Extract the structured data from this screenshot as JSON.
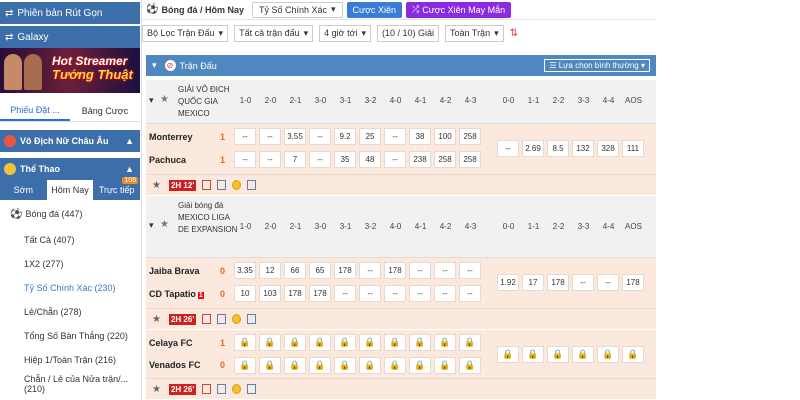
{
  "sidebar": {
    "btn_rutgon": "Phiên bản Rút Gọn",
    "btn_galaxy": "Galaxy",
    "banner_line1": "Hot Streamer",
    "banner_line2": "Tướng Thuật",
    "tabs": [
      "Phiếu Đặt ...",
      "Bảng Cược"
    ],
    "section_women": "Vô Địch Nữ Châu Âu",
    "section_sport": "Thể Thao",
    "subtabs": [
      "Sớm",
      "Hôm Nay",
      "Trực tiếp"
    ],
    "live_badge": "108",
    "menu": [
      {
        "label": "Bóng đá (447)"
      },
      {
        "label": "Tất Cả (407)"
      },
      {
        "label": "1X2 (277)"
      },
      {
        "label": "Tỷ Số Chính Xác (230)"
      },
      {
        "label": "Lẻ/Chẵn (278)"
      },
      {
        "label": "Tổng Số Bàn Thắng (220)"
      },
      {
        "label": "Hiệp 1/Toàn Trận (216)"
      },
      {
        "label": "Chẵn / Lẻ của Nửa trận/... (210)"
      }
    ]
  },
  "topbar": {
    "breadcrumb": "Bóng đá / Hôm Nay",
    "market_select": "Tỷ Số Chính Xác",
    "cuoc_xien": "Cược Xiên",
    "cuoc_xien_mm": "Cược Xiên May Mắn"
  },
  "filters": {
    "league": "Bộ Lọc Trận Đấu",
    "all": "Tất cả trận đấu",
    "time": "4 giờ tới",
    "count": "(10 / 10) Giải",
    "full": "Toàn Trận"
  },
  "main": {
    "header_title": "Trận Đấu",
    "sort_label": "Lựa chọn bình thường",
    "columns": [
      "1-0",
      "2-0",
      "2-1",
      "3-0",
      "3-1",
      "3-2",
      "4-0",
      "4-1",
      "4-2",
      "4-3",
      "0-0",
      "1-1",
      "2-2",
      "3-3",
      "4-4",
      "AOS"
    ],
    "leagues": [
      {
        "name": "GIẢI VÔ ĐỊCH QUỐC GIA MEXICO",
        "match": {
          "home": "Monterrey",
          "home_score": "1",
          "away": "Pachuca",
          "away_score": "1",
          "home_odds": [
            "--",
            "--",
            "3.55",
            "--",
            "9.2",
            "25",
            "--",
            "38",
            "100",
            "258"
          ],
          "away_odds": [
            "--",
            "--",
            "7",
            "--",
            "35",
            "48",
            "--",
            "238",
            "258",
            "258"
          ],
          "draw_odds": [
            "--",
            "2.69",
            "8.5",
            "132",
            "328",
            "111"
          ],
          "time": "2H 12'"
        }
      },
      {
        "name": "Giải bóng đá MEXICO LIGA DE EXPANSION",
        "match": {
          "home": "Jaiba Brava",
          "home_score": "0",
          "away": "CD Tapatio",
          "away_score": "0",
          "away_red": "1",
          "home_odds": [
            "3.35",
            "12",
            "66",
            "65",
            "178",
            "--",
            "178",
            "--",
            "--",
            "--"
          ],
          "away_odds": [
            "10",
            "103",
            "178",
            "178",
            "--",
            "--",
            "--",
            "--",
            "--",
            "--"
          ],
          "draw_odds": [
            "1.92",
            "17",
            "178",
            "--",
            "--",
            "178"
          ],
          "time": "2H 26'"
        }
      }
    ],
    "match3": {
      "home": "Celaya FC",
      "home_score": "1",
      "away": "Venados FC",
      "away_score": "0",
      "time": "2H 26'"
    }
  }
}
